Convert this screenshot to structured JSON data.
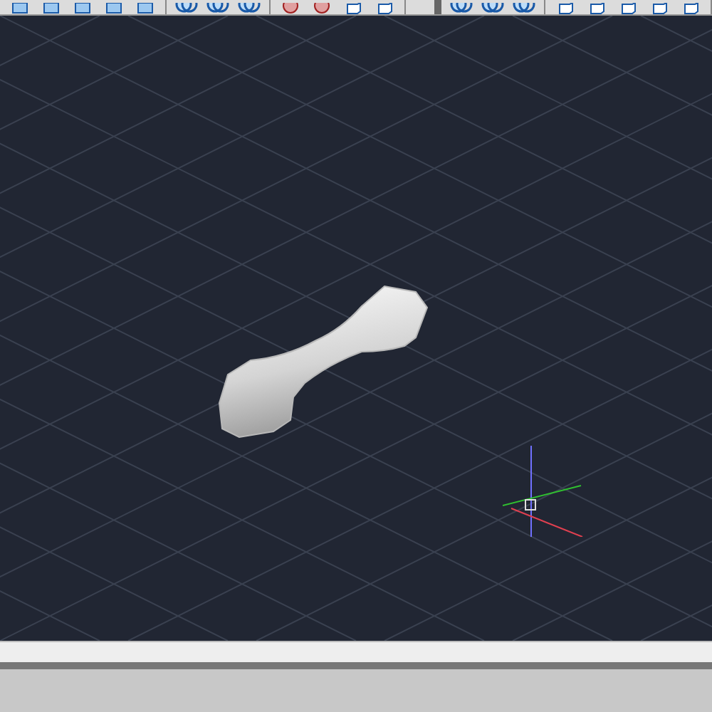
{
  "toolbars": [
    {
      "items": [
        {
          "kind": "solid"
        },
        {
          "kind": "solid"
        },
        {
          "kind": "solid"
        },
        {
          "kind": "solid"
        },
        {
          "kind": "solid"
        }
      ]
    },
    {
      "items": [
        {
          "kind": "boolean"
        },
        {
          "kind": "boolean"
        },
        {
          "kind": "boolean"
        }
      ]
    },
    {
      "items": [
        {
          "kind": "render"
        },
        {
          "kind": "render"
        },
        {
          "kind": "view"
        },
        {
          "kind": "view"
        }
      ]
    },
    {
      "items": [
        {
          "kind": "boolean"
        },
        {
          "kind": "boolean"
        },
        {
          "kind": "boolean"
        }
      ]
    },
    {
      "items": [
        {
          "kind": "view"
        },
        {
          "kind": "view"
        },
        {
          "kind": "view"
        },
        {
          "kind": "view"
        },
        {
          "kind": "view"
        }
      ]
    }
  ],
  "viewport": {
    "kind": "isometric",
    "ucs_icon": true
  }
}
